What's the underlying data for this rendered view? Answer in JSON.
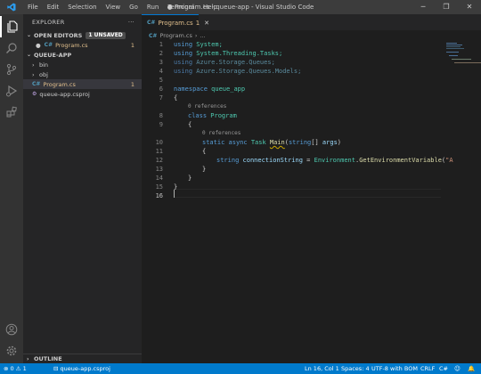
{
  "titlebar": {
    "menu": [
      "File",
      "Edit",
      "Selection",
      "View",
      "Go",
      "Run",
      "Terminal",
      "Help"
    ],
    "title": "● Program.cs - queue-app - Visual Studio Code",
    "minimize": "─",
    "maximize": "❐",
    "close": "✕"
  },
  "sidebar": {
    "title": "EXPLORER",
    "more": "···",
    "open_editors": {
      "label": "OPEN EDITORS",
      "badge": "1 UNSAVED",
      "items": [
        {
          "dot": "●",
          "icon": "C#",
          "name": "Program.cs",
          "problems": "1"
        }
      ]
    },
    "folder": {
      "label": "QUEUE-APP",
      "items": [
        {
          "chevron": "›",
          "name": "bin"
        },
        {
          "chevron": "›",
          "name": "obj"
        },
        {
          "icon": "C#",
          "name": "Program.cs",
          "problems": "1"
        },
        {
          "icon": "⚙",
          "name": "queue-app.csproj"
        }
      ]
    },
    "outline": "OUTLINE"
  },
  "tabs": [
    {
      "icon": "C#",
      "label": "Program.cs",
      "problems": "1",
      "close": "✕"
    }
  ],
  "breadcrumb": {
    "icon": "C#",
    "file": "Program.cs",
    "sep": "›",
    "more": "..."
  },
  "editor": {
    "line_numbers": [
      "1",
      "2",
      "3",
      "4",
      "5",
      "6",
      "7",
      "8",
      "9",
      "10",
      "11",
      "12",
      "13",
      "14",
      "15",
      "16"
    ],
    "lines": {
      "l1": [
        "using",
        " System;"
      ],
      "l2": [
        "using",
        " System.Threading.Tasks;"
      ],
      "l3": [
        "using",
        " Azure.Storage.Queues;"
      ],
      "l4": [
        "using",
        " Azure.Storage.Queues.Models;"
      ],
      "l6": [
        "namespace",
        " queue_app"
      ],
      "l7": "{",
      "lens1": "0 references",
      "l8": [
        "class",
        " Program"
      ],
      "l9": "{",
      "lens2": "0 references",
      "l10": [
        "static",
        " ",
        "async",
        " ",
        "Task",
        " ",
        "Main",
        "(",
        "string",
        "[] ",
        "args",
        ")"
      ],
      "l11": "{",
      "l12": [
        "string",
        " ",
        "connectionString",
        " = ",
        "Environment",
        ".",
        "GetEnvironmentVariable",
        "(",
        "\"A"
      ],
      "l13": "}",
      "l14": "}",
      "l15": "}"
    }
  },
  "status": {
    "errors": "⊗ 0 ⚠ 1",
    "project": "⊟ queue-app.csproj",
    "position": "Ln 16, Col 1",
    "spaces": "Spaces: 4",
    "encoding": "UTF-8 with BOM",
    "eol": "CRLF",
    "language": "C#",
    "feedback": "☺",
    "bell": "🔔"
  },
  "colors": {
    "accent": "#007acc",
    "keyword": "#569cd6",
    "type": "#4ec9b0",
    "function": "#dcdcaa",
    "string": "#ce9178"
  }
}
